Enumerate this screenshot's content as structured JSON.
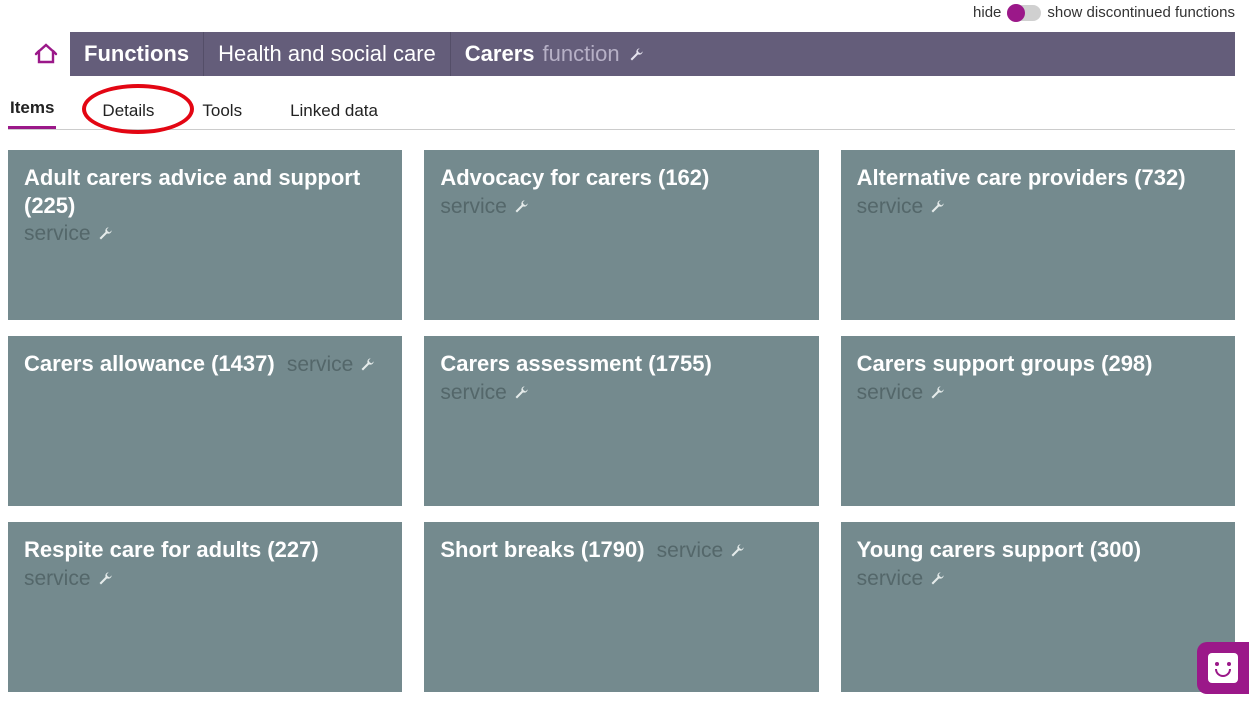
{
  "toggle": {
    "left_label": "hide",
    "right_label": "show discontinued functions"
  },
  "breadcrumb": {
    "functions": "Functions",
    "level1": "Health and social care",
    "level2": "Carers",
    "type_label": "function"
  },
  "tabs": {
    "items": "Items",
    "details": "Details",
    "tools": "Tools",
    "linked_data": "Linked data"
  },
  "service_label": "service",
  "cards": [
    {
      "title": "Adult carers advice and support",
      "count": "225",
      "same_row": false
    },
    {
      "title": "Advocacy for carers",
      "count": "162",
      "same_row": true
    },
    {
      "title": "Alternative care providers",
      "count": "732",
      "same_row": true
    },
    {
      "title": "Carers allowance",
      "count": "1437",
      "same_row": true,
      "svc_same_line": true
    },
    {
      "title": "Carers assessment",
      "count": "1755",
      "same_row": true
    },
    {
      "title": "Carers support groups",
      "count": "298",
      "same_row": true
    },
    {
      "title": "Respite care for adults",
      "count": "227",
      "same_row": true
    },
    {
      "title": "Short breaks",
      "count": "1790",
      "same_row": true,
      "svc_same_line": true
    },
    {
      "title": "Young carers support",
      "count": "300",
      "same_row": true
    }
  ]
}
